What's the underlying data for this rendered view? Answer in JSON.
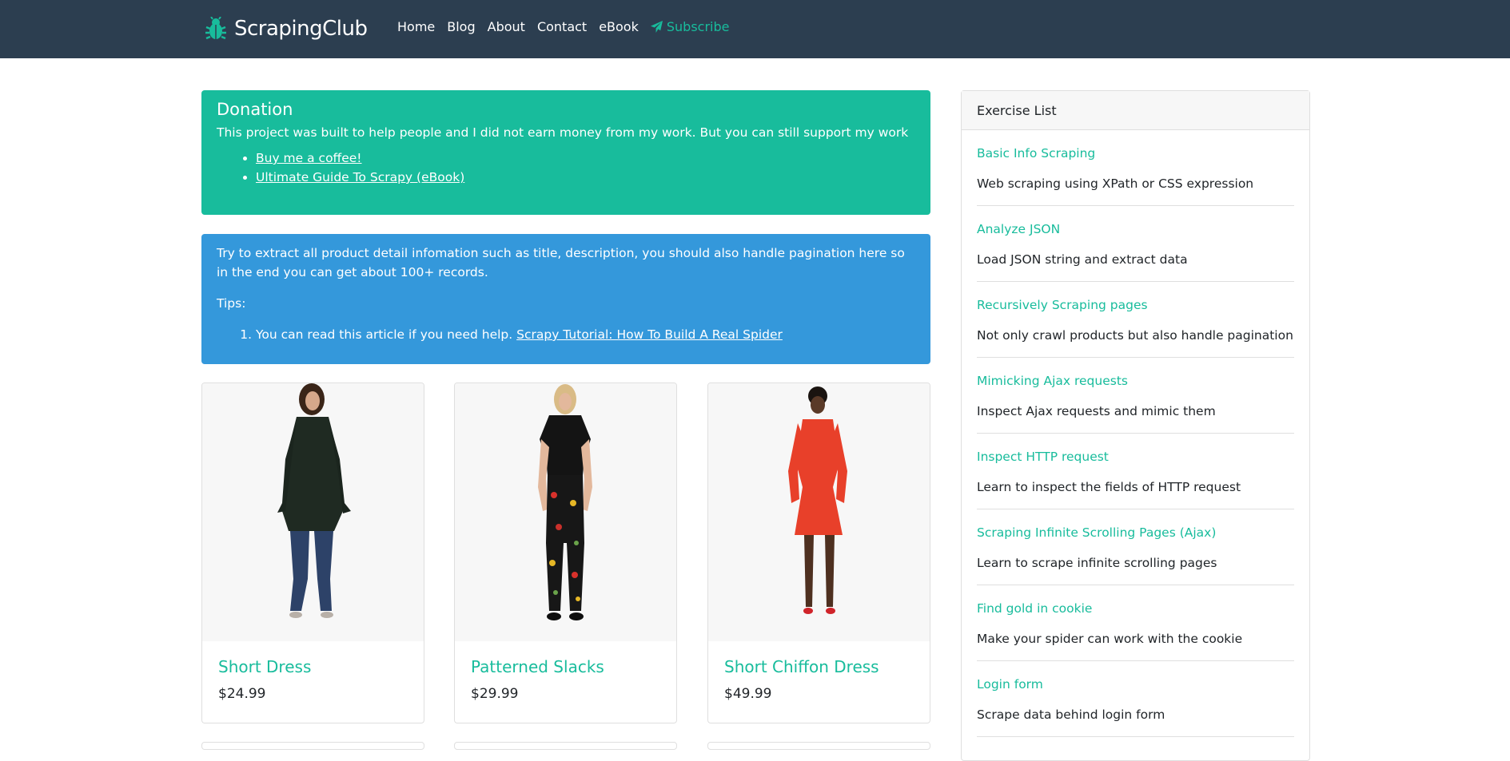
{
  "navbar": {
    "brand": "ScrapingClub",
    "items": [
      {
        "label": "Home"
      },
      {
        "label": "Blog"
      },
      {
        "label": "About"
      },
      {
        "label": "Contact"
      },
      {
        "label": "eBook"
      }
    ],
    "subscribe_label": "Subscribe",
    "colors": {
      "background": "#2c3e50",
      "accent": "#18bc9c"
    },
    "icons": {
      "logo": "bug-icon",
      "subscribe": "paper-plane-icon"
    }
  },
  "donation": {
    "title": "Donation",
    "text": "This project was built to help people and I did not earn money from my work. But you can still support my work",
    "links": [
      {
        "label": "Buy me a coffee!"
      },
      {
        "label": "Ultimate Guide To Scrapy (eBook)"
      }
    ],
    "color": "#18bc9c"
  },
  "tips": {
    "intro": "Try to extract all product detail infomation such as title, description, you should also handle pagination here so in the end you can get about 100+ records.",
    "heading": "Tips:",
    "item_text": "You can read this article if you need help.",
    "item_link": "Scrapy Tutorial: How To Build A Real Spider",
    "color": "#3498db"
  },
  "products": [
    {
      "title": "Short Dress",
      "price": "$24.99"
    },
    {
      "title": "Patterned Slacks",
      "price": "$29.99"
    },
    {
      "title": "Short Chiffon Dress",
      "price": "$49.99"
    }
  ],
  "sidebar": {
    "header": "Exercise List",
    "exercises": [
      {
        "title": "Basic Info Scraping",
        "desc": "Web scraping using XPath or CSS expression"
      },
      {
        "title": "Analyze JSON",
        "desc": "Load JSON string and extract data"
      },
      {
        "title": "Recursively Scraping pages",
        "desc": "Not only crawl products but also handle pagination"
      },
      {
        "title": "Mimicking Ajax requests",
        "desc": "Inspect Ajax requests and mimic them"
      },
      {
        "title": "Inspect HTTP request",
        "desc": "Learn to inspect the fields of HTTP request"
      },
      {
        "title": "Scraping Infinite Scrolling Pages (Ajax)",
        "desc": "Learn to scrape infinite scrolling pages"
      },
      {
        "title": "Find gold in cookie",
        "desc": "Make your spider can work with the cookie"
      },
      {
        "title": "Login form",
        "desc": "Scrape data behind login form"
      }
    ]
  }
}
